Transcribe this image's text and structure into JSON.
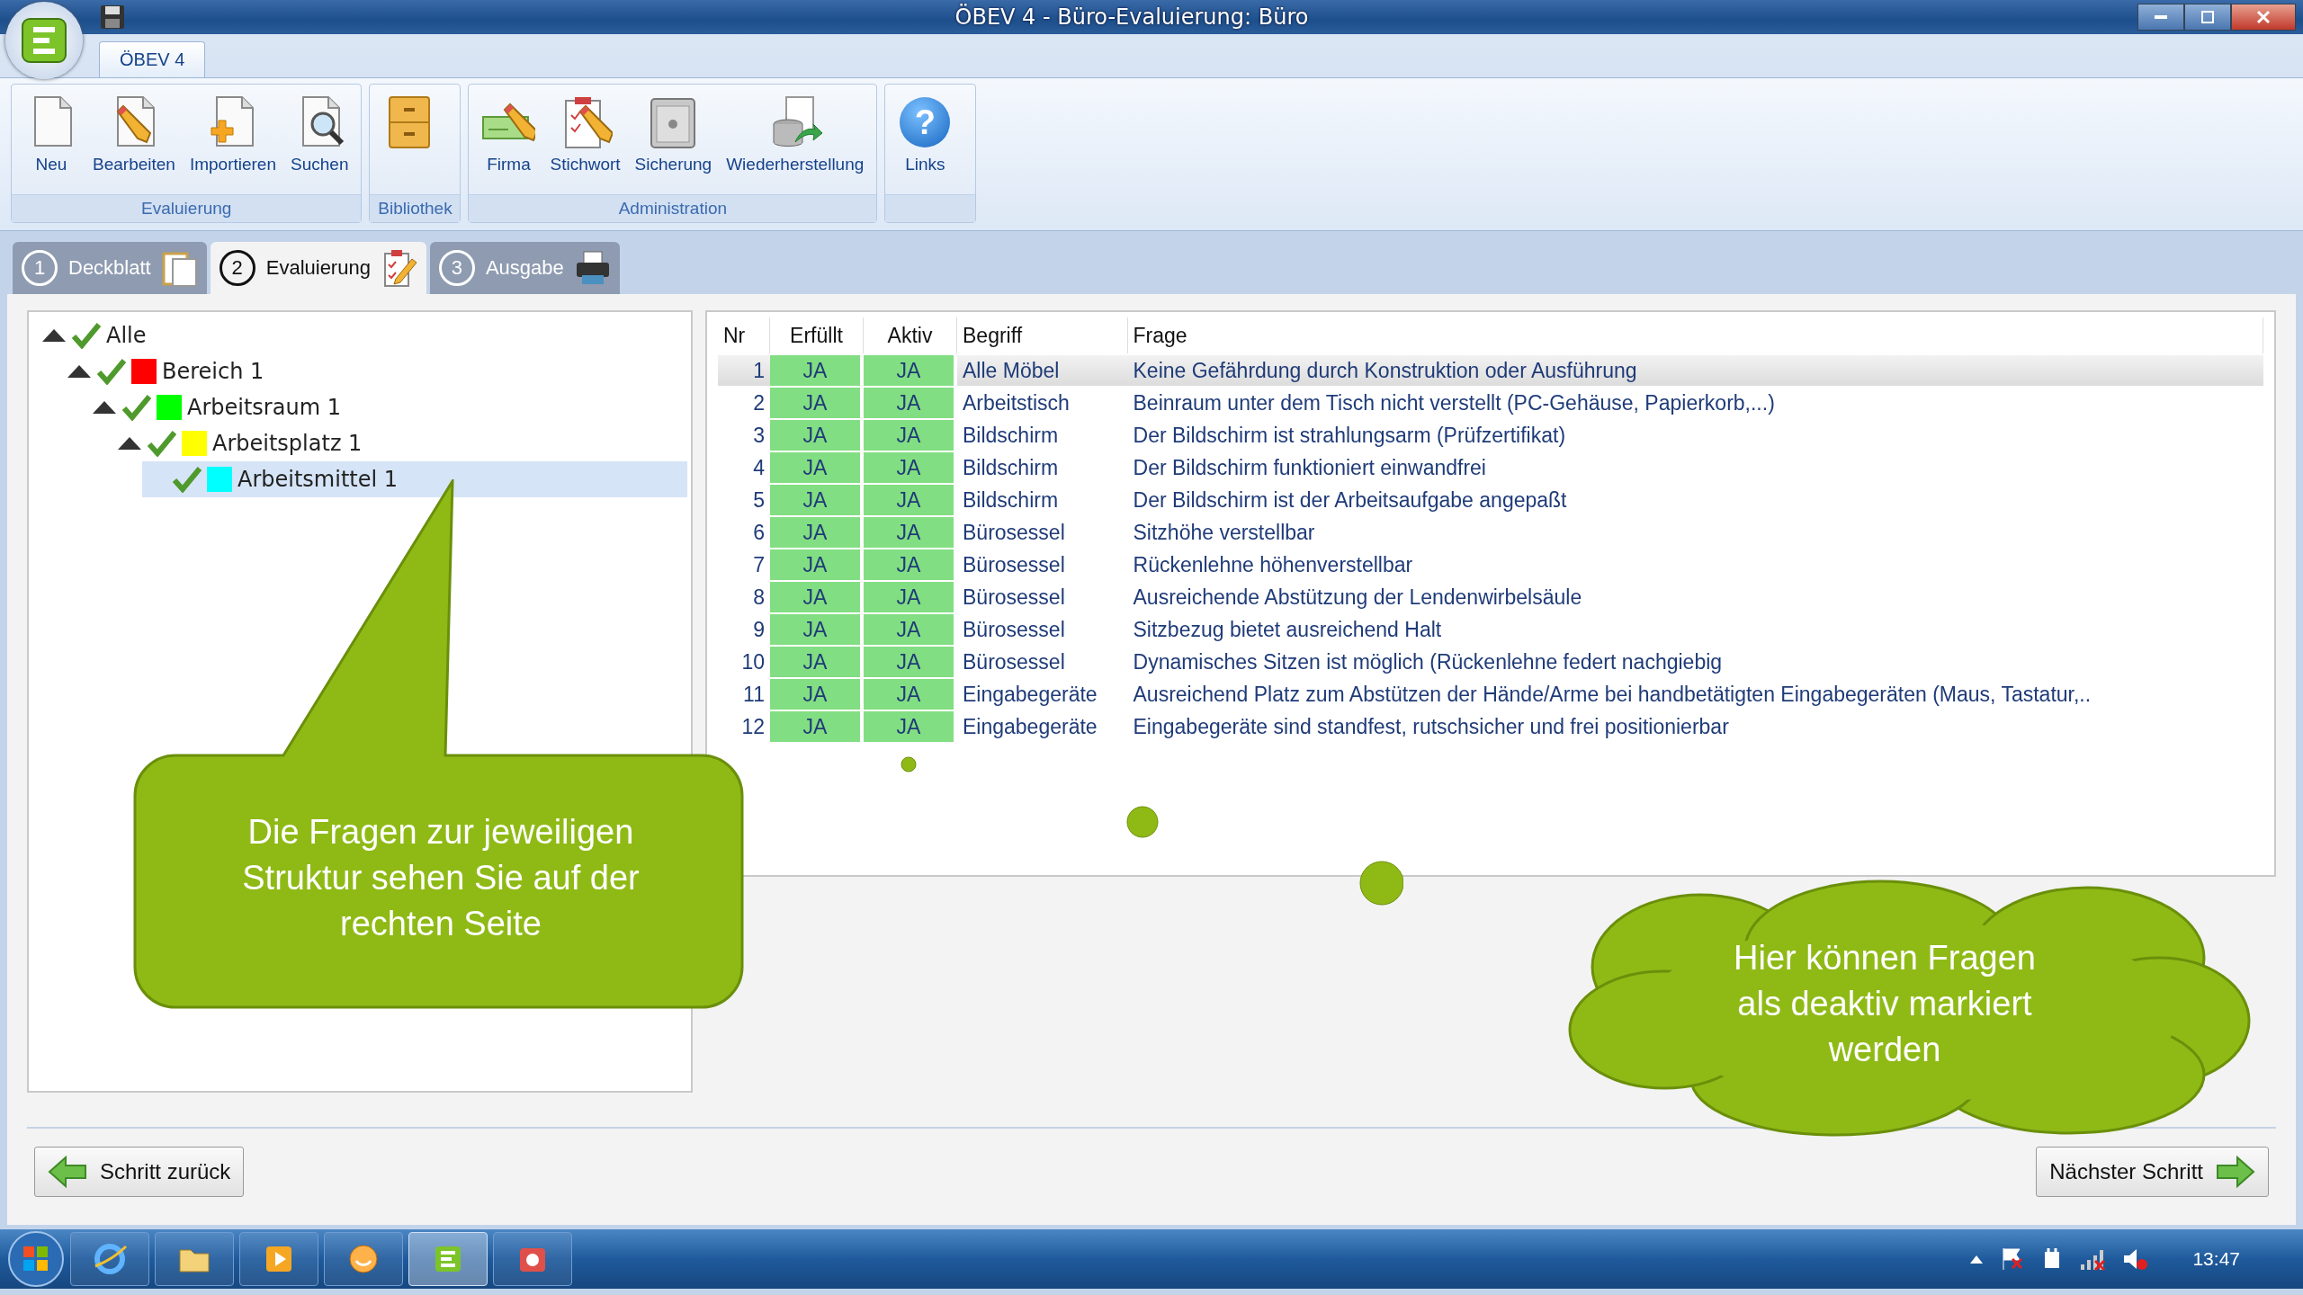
{
  "window": {
    "title": "ÖBEV 4 - Büro-Evaluierung: Büro"
  },
  "ribbon": {
    "tabs": [
      {
        "label": "ÖBEV 4",
        "selected": true
      }
    ],
    "groups": [
      {
        "label": "Evaluierung",
        "buttons": [
          {
            "kind": "new",
            "label": "Neu"
          },
          {
            "kind": "edit",
            "label": "Bearbeiten"
          },
          {
            "kind": "import",
            "label": "Importieren"
          },
          {
            "kind": "search",
            "label": "Suchen"
          }
        ]
      },
      {
        "label": "Bibliothek",
        "buttons": [
          {
            "kind": "cabinet"
          }
        ]
      },
      {
        "label": "Administration",
        "buttons": [
          {
            "kind": "company",
            "label": "Firma"
          },
          {
            "kind": "keyword",
            "label": "Stichwort"
          },
          {
            "kind": "backup",
            "label": "Sicherung"
          },
          {
            "kind": "restore",
            "label": "Wiederherstellung"
          }
        ]
      },
      {
        "buttons": [
          {
            "kind": "help",
            "label": "Links",
            "glyph": "?"
          }
        ]
      }
    ]
  },
  "steps": [
    {
      "number": "1",
      "label": "Deckblatt",
      "kind": "cover",
      "selected": false
    },
    {
      "number": "2",
      "label": "Evaluierung",
      "kind": "evaluate",
      "selected": true
    },
    {
      "number": "3",
      "label": "Ausgabe",
      "kind": "print",
      "selected": false
    }
  ],
  "tree": {
    "items": [
      {
        "label": "Alle",
        "checked": true,
        "expanded": true,
        "selected": false,
        "children": [
          {
            "label": "Bereich 1",
            "color": "#ff0000",
            "checked": true,
            "expanded": true,
            "selected": false,
            "children": [
              {
                "label": "Arbeitsraum 1",
                "color": "#00ff00",
                "checked": true,
                "expanded": true,
                "selected": false,
                "children": [
                  {
                    "label": "Arbeitsplatz 1",
                    "color": "#ffff00",
                    "checked": true,
                    "expanded": true,
                    "selected": false,
                    "children": [
                      {
                        "label": "Arbeitsmittel 1",
                        "color": "#00ffff",
                        "checked": true,
                        "selected": true
                      }
                    ]
                  }
                ]
              }
            ]
          }
        ]
      }
    ]
  },
  "table": {
    "columns": [
      "Nr",
      "Erfüllt",
      "Aktiv",
      "Begriff",
      "Frage"
    ],
    "rows": [
      {
        "nr": "1",
        "erfuellt": "JA",
        "aktiv": "JA",
        "begriff": "Alle Möbel",
        "frage": "Keine Gefährdung durch Konstruktion oder Ausführung",
        "selected": true
      },
      {
        "nr": "2",
        "erfuellt": "JA",
        "aktiv": "JA",
        "begriff": "Arbeitstisch",
        "frage": "Beinraum unter dem Tisch nicht verstellt (PC-Gehäuse, Papierkorb,...)",
        "selected": false
      },
      {
        "nr": "3",
        "erfuellt": "JA",
        "aktiv": "JA",
        "begriff": "Bildschirm",
        "frage": "Der Bildschirm ist strahlungsarm (Prüfzertifikat)",
        "selected": false
      },
      {
        "nr": "4",
        "erfuellt": "JA",
        "aktiv": "JA",
        "begriff": "Bildschirm",
        "frage": "Der Bildschirm funktioniert einwandfrei",
        "selected": false
      },
      {
        "nr": "5",
        "erfuellt": "JA",
        "aktiv": "JA",
        "begriff": "Bildschirm",
        "frage": "Der Bildschirm ist der Arbeitsaufgabe angepaßt",
        "selected": false
      },
      {
        "nr": "6",
        "erfuellt": "JA",
        "aktiv": "JA",
        "begriff": "Bürosessel",
        "frage": "Sitzhöhe verstellbar",
        "selected": false
      },
      {
        "nr": "7",
        "erfuellt": "JA",
        "aktiv": "JA",
        "begriff": "Bürosessel",
        "frage": "Rückenlehne höhenverstellbar",
        "selected": false
      },
      {
        "nr": "8",
        "erfuellt": "JA",
        "aktiv": "JA",
        "begriff": "Bürosessel",
        "frage": "Ausreichende Abstützung der Lendenwirbelsäule",
        "selected": false
      },
      {
        "nr": "9",
        "erfuellt": "JA",
        "aktiv": "JA",
        "begriff": "Bürosessel",
        "frage": "Sitzbezug bietet ausreichend Halt",
        "selected": false
      },
      {
        "nr": "10",
        "erfuellt": "JA",
        "aktiv": "JA",
        "begriff": "Bürosessel",
        "frage": "Dynamisches Sitzen ist möglich (Rückenlehne federt nachgiebig",
        "selected": false
      },
      {
        "nr": "11",
        "erfuellt": "JA",
        "aktiv": "JA",
        "begriff": "Eingabegeräte",
        "frage": "Ausreichend Platz zum Abstützen der Hände/Arme bei handbetätigten Eingabegeräten (Maus, Tastatur,..",
        "selected": false
      },
      {
        "nr": "12",
        "erfuellt": "JA",
        "aktiv": "JA",
        "begriff": "Eingabegeräte",
        "frage": "Eingabegeräte sind standfest, rutschsicher und frei positionierbar",
        "selected": false
      }
    ]
  },
  "callouts": [
    {
      "kind": "speech",
      "text": "Die Fragen zur jeweiligen Struktur sehen Sie auf der rechten Seite"
    },
    {
      "kind": "thought",
      "text": "Hier können Fragen als deaktiv markiert werden"
    }
  ],
  "navigation": {
    "back": "Schritt zurück",
    "next": "Nächster Schritt"
  },
  "taskbar": {
    "apps": [
      {
        "kind": "browser",
        "selected": false
      },
      {
        "kind": "folder",
        "selected": false
      },
      {
        "kind": "media",
        "selected": false
      },
      {
        "kind": "messenger",
        "selected": false
      },
      {
        "kind": "app",
        "selected": true
      },
      {
        "kind": "camera",
        "selected": false
      }
    ],
    "clock": "13:47"
  }
}
